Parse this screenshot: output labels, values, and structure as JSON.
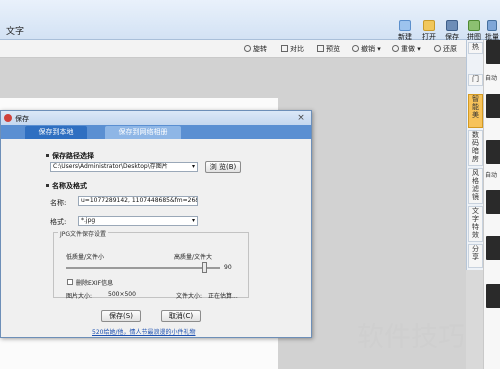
{
  "topbar": {
    "menu_label": "文字",
    "buttons": [
      {
        "label": "新建",
        "icon": "new-icon"
      },
      {
        "label": "打开",
        "icon": "open-icon"
      },
      {
        "label": "保存",
        "icon": "save-icon"
      },
      {
        "label": "拼图",
        "icon": "puzzle-icon"
      },
      {
        "label": "批量",
        "icon": "batch-icon"
      }
    ]
  },
  "toolbar2": {
    "items": [
      "旋转",
      "对比",
      "预览",
      "撤销",
      "重做",
      "还原"
    ]
  },
  "side_tabs": [
    "热",
    "门",
    "智能美",
    "数码暗房",
    "风格滤镜",
    "文字特效",
    "分享"
  ],
  "thumbs": [
    "自动",
    "自动"
  ],
  "dialog": {
    "title": "保存",
    "tabs": [
      "保存到本地",
      "保存到网络相册"
    ],
    "path_section": "保存路径选择",
    "path_value": "C:\\Users\\Administrator\\Desktop\\存图片",
    "browse_label": "浏 览(B)",
    "name_section": "名称及格式",
    "name_label": "名称:",
    "name_value": "u=1077289142, 1107448685&fm=26&gp=0_",
    "format_label": "格式:",
    "format_value": "*.jpg",
    "settings_group": "JPG文件保存设置",
    "low_quality": "低质量/文件小",
    "high_quality": "高质量/文件大",
    "quality_value": "90",
    "quality_fraction": 0.9,
    "exif_label": "删除EXIF信息",
    "image_size_label": "图片大小:",
    "image_size_value": "500×500",
    "file_size_label": "文件大小:",
    "file_size_value": "正在估算...",
    "save_label": "保存(S)",
    "cancel_label": "取消(C)",
    "promo_link": "520给她/他，情人节最浪漫的小件礼物"
  },
  "watermark": "软件技巧"
}
